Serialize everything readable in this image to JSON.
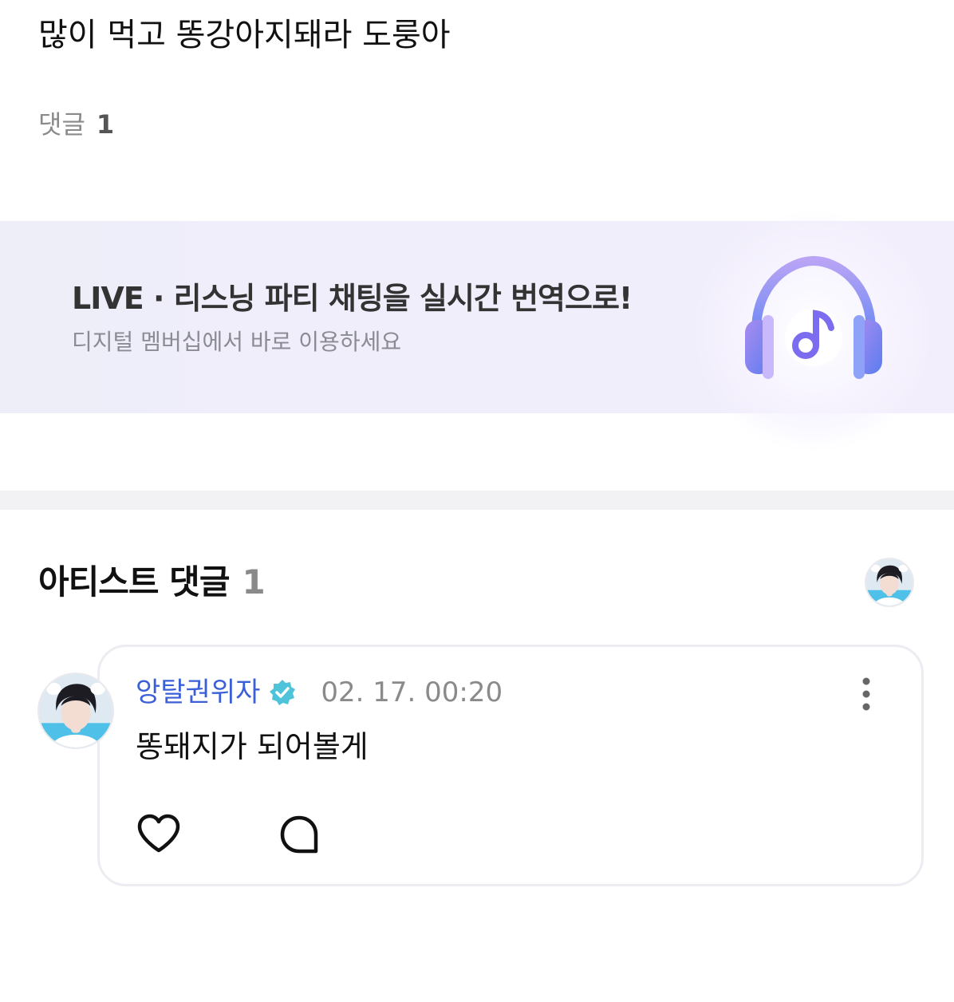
{
  "post": {
    "text": "많이 먹고 똥강아지돼라 도룽아"
  },
  "comments_summary": {
    "label": "댓글",
    "count": "1"
  },
  "banner": {
    "title": "LIVE · 리스닝 파티 채팅을 실시간 번역으로!",
    "subtitle": "디지털 멤버십에서 바로 이용하세요",
    "icon": "headphones-music-icon"
  },
  "artist_comments": {
    "title": "아티스트 댓글",
    "count": "1",
    "items": [
      {
        "author": "앙탈권위자",
        "verified": true,
        "timestamp": "02. 17. 00:20",
        "text": "똥돼지가 되어볼게"
      }
    ]
  },
  "colors": {
    "author_name": "#3a5fd6",
    "verified_badge": "#4fc3d9",
    "banner_bg": "#eeeef9",
    "divider": "#f2f2f4"
  }
}
